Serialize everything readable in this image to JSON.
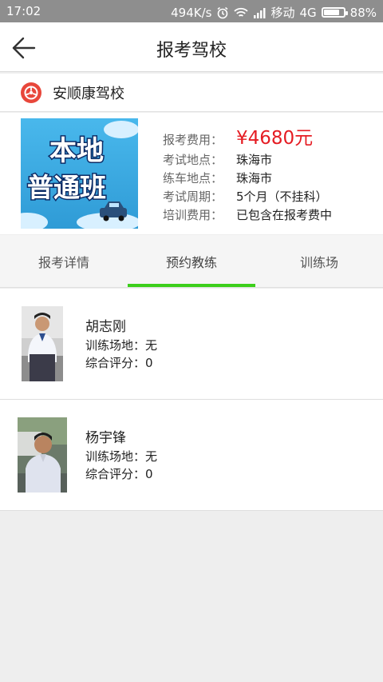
{
  "status_bar": {
    "time": "17:02",
    "speed": "494K/s",
    "carrier": "移动",
    "network": "4G",
    "battery": "88%",
    "battery_level": 0.88
  },
  "header": {
    "title": "报考驾校",
    "back_icon": "arrow-left-icon"
  },
  "school": {
    "name": "安顺康驾校",
    "logo_icon": "driving-school-logo-icon",
    "logo_color": "#e8473b"
  },
  "promo_banner": {
    "line1": "本地",
    "line2": "普通班"
  },
  "info": {
    "price_label": "报考费用：",
    "price_value": "¥4680元",
    "exam_location_label": "考试地点：",
    "exam_location_value": "珠海市",
    "practice_location_label": "练车地点：",
    "practice_location_value": "珠海市",
    "exam_cycle_label": "考试周期：",
    "exam_cycle_value": "5个月（不挂科）",
    "training_fee_label": "培训费用：",
    "training_fee_value": "已包含在报考费中",
    "price_color": "#e51c23"
  },
  "tabs": [
    {
      "label": "报考详情",
      "active": false
    },
    {
      "label": "预约教练",
      "active": true
    },
    {
      "label": "训练场",
      "active": false
    }
  ],
  "tab_indicator_color": "#3ccf1b",
  "coaches": [
    {
      "name": "胡志刚",
      "venue": "训练场地：无",
      "rating": "综合评分：0"
    },
    {
      "name": "杨宇锋",
      "venue": "训练场地：无",
      "rating": "综合评分：0"
    }
  ]
}
